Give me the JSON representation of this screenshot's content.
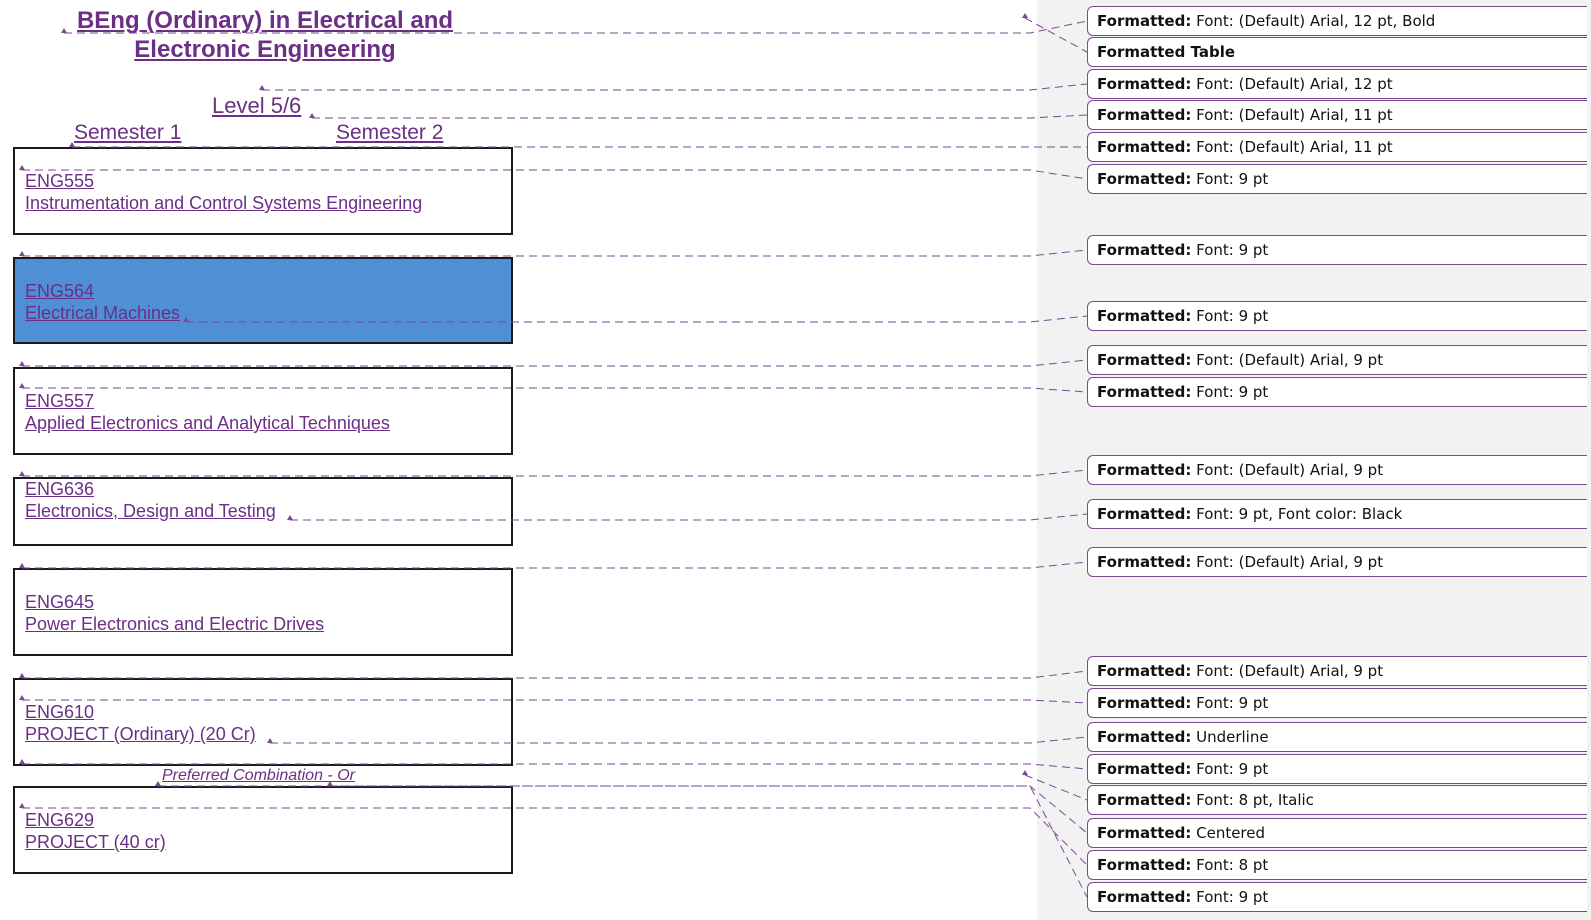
{
  "document": {
    "title_line1": "BEng (Ordinary) in Electrical and",
    "title_line2": "Electronic Engineering",
    "level": "Level 5/6",
    "semester1": "Semester 1",
    "semester2": "Semester 2",
    "modules": [
      {
        "code": "ENG555",
        "name": "Instrumentation and Control Systems Engineering"
      },
      {
        "code": "ENG564",
        "name": "Electrical Machines"
      },
      {
        "code": "ENG557",
        "name": "Applied Electronics and Analytical Techniques"
      },
      {
        "code": "ENG636",
        "name": "Electronics, Design and Testing"
      },
      {
        "code": "ENG645",
        "name": "Power Electronics and Electric Drives"
      },
      {
        "code": "ENG610",
        "name": "PROJECT  (Ordinary) (20 Cr)"
      },
      {
        "code": "ENG629",
        "name": "PROJECT (40 cr)"
      }
    ],
    "combination_note": "Preferred Combination - Or"
  },
  "balloons": [
    {
      "label": "Formatted:",
      "text": "Font: (Default) Arial, 12 pt, Bold"
    },
    {
      "label": "Formatted Table",
      "text": ""
    },
    {
      "label": "Formatted:",
      "text": "Font: (Default) Arial, 12 pt"
    },
    {
      "label": "Formatted:",
      "text": "Font: (Default) Arial, 11 pt"
    },
    {
      "label": "Formatted:",
      "text": "Font: (Default) Arial, 11 pt"
    },
    {
      "label": "Formatted:",
      "text": "Font: 9 pt"
    },
    {
      "label": "Formatted:",
      "text": "Font: 9 pt"
    },
    {
      "label": "Formatted:",
      "text": "Font: 9 pt"
    },
    {
      "label": "Formatted:",
      "text": "Font: (Default) Arial, 9 pt"
    },
    {
      "label": "Formatted:",
      "text": "Font: 9 pt"
    },
    {
      "label": "Formatted:",
      "text": "Font: (Default) Arial, 9 pt"
    },
    {
      "label": "Formatted:",
      "text": "Font: 9 pt, Font color: Black"
    },
    {
      "label": "Formatted:",
      "text": "Font: (Default) Arial, 9 pt"
    },
    {
      "label": "Formatted:",
      "text": "Font: (Default) Arial, 9 pt"
    },
    {
      "label": "Formatted:",
      "text": "Font: 9 pt"
    },
    {
      "label": "Formatted:",
      "text": "Underline"
    },
    {
      "label": "Formatted:",
      "text": "Font: 9 pt"
    },
    {
      "label": "Formatted:",
      "text": "Font: 8 pt, Italic"
    },
    {
      "label": "Formatted:",
      "text": "Centered"
    },
    {
      "label": "Formatted:",
      "text": "Font: 8 pt"
    },
    {
      "label": "Formatted:",
      "text": "Font: 9 pt"
    }
  ],
  "colors": {
    "revision": "#6b2f86",
    "selection": "#4f8fd6",
    "margin_pane": "#f2f2f2"
  }
}
